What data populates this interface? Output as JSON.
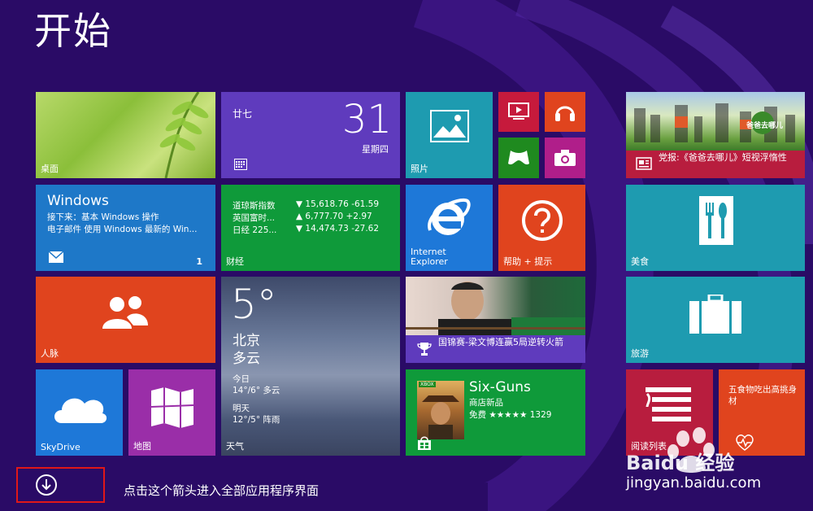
{
  "start": {
    "title": "开始"
  },
  "tiles": {
    "desktop": {
      "label": "桌面"
    },
    "calendar": {
      "lunar": "廿七",
      "date": "31",
      "weekday": "星期四"
    },
    "photos": {
      "label": "照片"
    },
    "news": {
      "headline": "党报:《爸爸去哪儿》短视浮惰性",
      "logo_text": "爸爸去哪儿"
    },
    "mail": {
      "title": "Windows",
      "line1": "接下来：基本 Windows 操作",
      "line2": "电子邮件 使用 Windows 最新的 Win...",
      "count": "1"
    },
    "finance": {
      "label": "财经",
      "rows": [
        {
          "name": "道琼斯指数",
          "value": "▼ 15,618.76 -61.59"
        },
        {
          "name": "英国富时...",
          "value": "▲ 6,777.70 +2.97"
        },
        {
          "name": "日经 225...",
          "value": "▼ 14,474.73 -27.62"
        }
      ]
    },
    "ie": {
      "label_line1": "Internet",
      "label_line2": "Explorer"
    },
    "help": {
      "label": "帮助 + 提示"
    },
    "food": {
      "label": "美食"
    },
    "people": {
      "label": "人脉"
    },
    "weather": {
      "label": "天气",
      "temp": "5°",
      "city": "北京",
      "condition": "多云",
      "today_label": "今日",
      "today_forecast": "14°/6° 多云",
      "tomorrow_label": "明天",
      "tomorrow_forecast": "12°/5° 阵雨"
    },
    "sports": {
      "headline": "国锦赛-梁文博连赢5局逆转火箭"
    },
    "travel": {
      "label": "旅游"
    },
    "skydrive": {
      "label": "SkyDrive"
    },
    "maps": {
      "label": "地图"
    },
    "store": {
      "game": "Six-Guns",
      "category": "商店新品",
      "price": "免费 ★★★★★ 1329",
      "badge": "XBOX"
    },
    "reading": {
      "label": "阅读列表"
    },
    "food2": {
      "text": "五食物吃出高挑身材"
    }
  },
  "hint": {
    "text": "点击这个箭头进入全部应用程序界面"
  },
  "watermark": {
    "brand": "Baidu 经验",
    "url": "jingyan.baidu.com"
  },
  "colors": {
    "background": "#2a0b66",
    "highlight": "#e01818"
  }
}
